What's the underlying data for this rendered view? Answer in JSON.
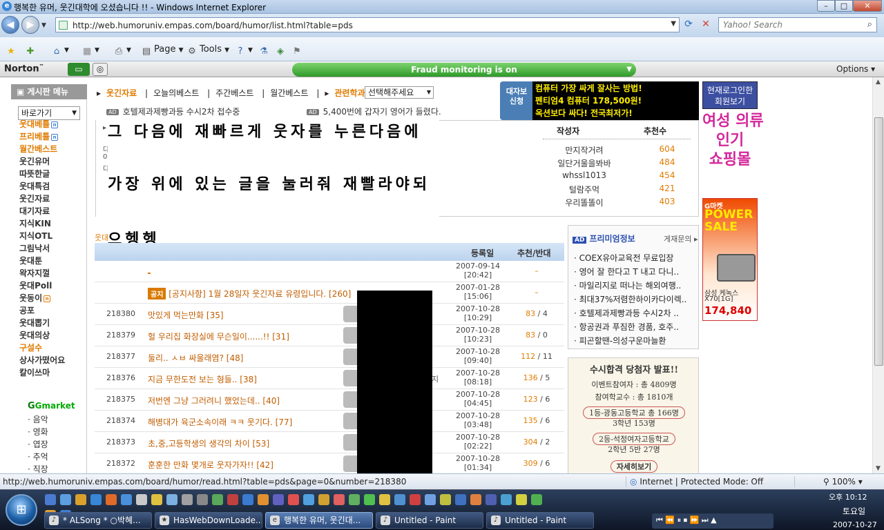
{
  "window": {
    "title": "행복한 유머, 웃긴대학에 오셨습니다 !! - Windows Internet Explorer",
    "min": "–",
    "max": "□",
    "close": "✕"
  },
  "address": {
    "url": "http://web.humoruniv.empas.com/board/humor/list.html?table=pds",
    "search_placeholder": "Yahoo! Search"
  },
  "commandbar": {
    "page": "Page",
    "tools": "Tools"
  },
  "norton": {
    "logo": "Norton",
    "tm": "™",
    "fraud": "Fraud monitoring is on",
    "options": "Options"
  },
  "sidebar": {
    "header": "게시판 메뉴",
    "goto": "바로가기",
    "items": [
      {
        "label": "웃대베틀"
      },
      {
        "label": "프리베틀"
      },
      {
        "label": "월간베스트"
      },
      {
        "label": "웃긴유머"
      },
      {
        "label": "따뜻한글"
      },
      {
        "label": "웃대특검"
      },
      {
        "label": "웃긴자료"
      },
      {
        "label": "대기자료"
      },
      {
        "label": "지식KIN"
      },
      {
        "label": "지식OTL"
      },
      {
        "label": "그림낙서"
      },
      {
        "label": "웃대툰"
      },
      {
        "label": "왁자지껄"
      },
      {
        "label": "웃대Poll"
      },
      {
        "label": "웃동이"
      },
      {
        "label": "공포"
      },
      {
        "label": "웃대뽑기"
      },
      {
        "label": "웃대의상"
      },
      {
        "label": "구설수"
      },
      {
        "label": "상사가떴어요"
      },
      {
        "label": "칼이쓰마"
      }
    ],
    "gmarket": "Gmarket",
    "sub_items": [
      "· 음악",
      "· 영화",
      "· 엽장",
      "· 추억",
      "· 직장"
    ]
  },
  "topnav": {
    "current": "웃긴자료",
    "links": [
      "오늘의베스트",
      "주간베스트",
      "월간베스트"
    ],
    "related": "관련학과",
    "select": "선택해주세요",
    "ad1": "호텔제과제빵과등 수시2차 접수중",
    "ad2": "5,400번에 갑자기 영어가 들렸다.",
    "ad_label": "AD"
  },
  "overlay": {
    "line1": "그 다음에 재빠르게 웃자를 누른다음에",
    "line2": "가장 위에 있는 글을 눌러줘 재빨라야되",
    "line3": "으헹헹"
  },
  "best": {
    "author_header": "작성자",
    "rec_header": "추천수",
    "rows": [
      {
        "name": "만지작거려",
        "score": "604"
      },
      {
        "name": "일단거울을봐바",
        "score": "484"
      },
      {
        "name": "whssl1013",
        "score": "454"
      },
      {
        "name": "털람주먹",
        "score": "421"
      },
      {
        "name": "우리똘똘이",
        "score": "403"
      }
    ]
  },
  "ads": {
    "badge": "대자보\n신청",
    "black1": "컴퓨터 가장 싸게 잘사는 방법!",
    "black2": "펜티엄4 컴퓨터 178,500원!",
    "black3": "옥션보다 싸다! 전국최저가!",
    "login": "현재로그인한\n회원보기",
    "shop": "여성 의류\n인기\n쇼핑몰",
    "power_gm": "G마켓",
    "power": "POWER SALE",
    "power_model1": "삼성 케녹스",
    "power_model2": "X70[1G]",
    "power_price": "174,840"
  },
  "table": {
    "woot": "웃대",
    "header_date": "등록일",
    "header_rec": "추천/반대",
    "rows": [
      {
        "num": "",
        "title": "",
        "date1": "2007-09-14",
        "date2": "[20:42]",
        "rec": "–",
        "opp": "",
        "notice": ""
      },
      {
        "num": "",
        "title": "[공지사항] 1월 28일자 웃긴자료 유령입니다. [260]",
        "date1": "2007-01-28",
        "date2": "[15:06]",
        "rec": "–",
        "opp": "",
        "notice": "공지"
      },
      {
        "num": "218380",
        "title": "맛있게 먹는만화 [35]",
        "date1": "2007-10-28",
        "date2": "[10:29]",
        "rec": "83",
        "opp": " / 4",
        "notice": ""
      },
      {
        "num": "218379",
        "title": "헐 우리집 화장실에 무슨일이......!! [31]",
        "date1": "2007-10-28",
        "date2": "[10:23]",
        "rec": "83",
        "opp": " / 0",
        "notice": ""
      },
      {
        "num": "218377",
        "title": "둘리.. ㅅㅂ 싸울래염? [48]",
        "date1": "2007-10-28",
        "date2": "[09:40]",
        "rec": "112",
        "opp": " / 11",
        "notice": ""
      },
      {
        "num": "218376",
        "title": "지금 무한도전 보는 형들.. [38]",
        "date1": "2007-10-28",
        "date2": "[08:18]",
        "rec": "136",
        "opp": " / 5",
        "notice": ""
      },
      {
        "num": "218375",
        "title": "저번엔 그냥 그러려니 했었는데.. [40]",
        "date1": "2007-10-28",
        "date2": "[04:45]",
        "rec": "123",
        "opp": " / 6",
        "notice": ""
      },
      {
        "num": "218374",
        "title": "해병대가 육군소속이래 ㅋㅋ 웃기다. [77]",
        "date1": "2007-10-28",
        "date2": "[03:48]",
        "rec": "135",
        "opp": " / 6",
        "notice": ""
      },
      {
        "num": "218373",
        "title": "초,중,고등학생의 생각의 차이 [53]",
        "date1": "2007-10-28",
        "date2": "[02:22]",
        "rec": "304",
        "opp": " / 2",
        "notice": ""
      },
      {
        "num": "218372",
        "title": "훈훈한 만화 몇개로 웃자가자!! [42]",
        "date1": "2007-10-28",
        "date2": "[01:34]",
        "rec": "309",
        "opp": " / 6",
        "notice": ""
      }
    ],
    "side_char": "지"
  },
  "premium": {
    "ad": "AD",
    "title": "프리미엄정보",
    "inquiry": "게재문의",
    "items": [
      "· COEX유아교육전 무료입장",
      "· 영어 잘 한다고 T 내고 다니..",
      "· 마일리지로 떠나는 해외여행..",
      "· 최대37%저렴한하이카다이렉..",
      "· 호텔제과제빵과등 수시2차 ..",
      "· 항공권과 푸짐한 경품, 호주..",
      "· 피곤할땐-의성구운마늘환"
    ]
  },
  "result": {
    "title": "수시합격 당첨자 발표!!",
    "l1": "이벤트참여자 : 총 4809명",
    "l2": "참여학교수 : 총 1810개",
    "l3": "1등-광동고등학교 총 166명",
    "l4": "3학년 153명",
    "l5": "2등-석정여자고등학교",
    "l6": "2학년 5반 27명",
    "more": "자세히보기"
  },
  "status": {
    "url": "http://web.humoruniv.empas.com/board/humor/read.html?table=pds&page=0&number=218380",
    "zone": "Internet | Protected Mode: Off",
    "zoom": "100%"
  },
  "taskbar": {
    "tasks": [
      "* ALSong * ○박혜...",
      "HasWebDownLoade...",
      "행복한 유머, 웃긴대...",
      "Untitled - Paint",
      "Untitled - Paint"
    ],
    "time": "오후 10:12",
    "day": "토요일",
    "date": "2007-10-27"
  },
  "colors": {
    "accent_orange": "#e07b00",
    "fraud_green": "#2f9a2a",
    "ie_blue": "#c3d6ec"
  }
}
